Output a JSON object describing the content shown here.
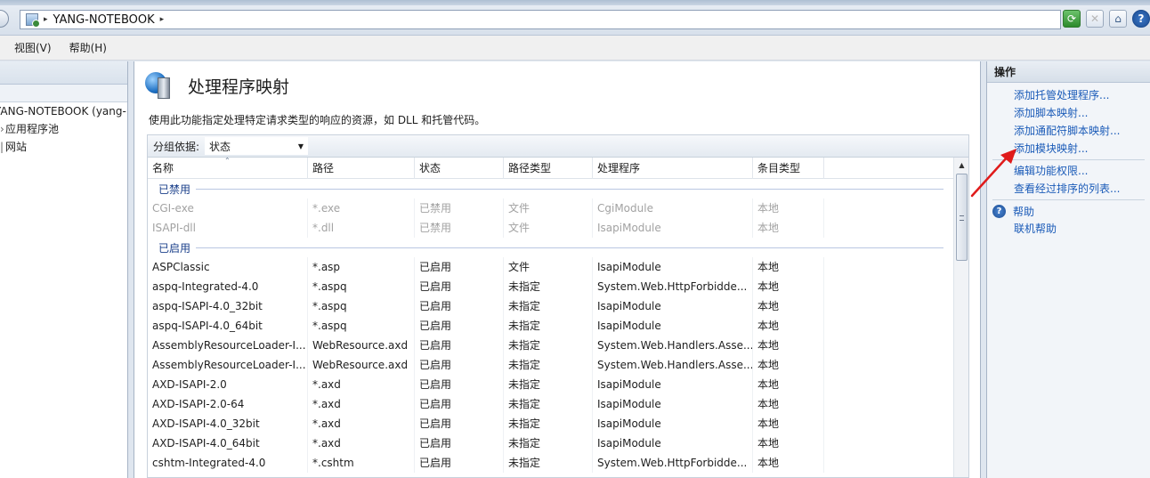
{
  "addressbar": {
    "crumb": "YANG-NOTEBOOK",
    "sep1": "▸",
    "sep2": "▸"
  },
  "menu": [
    {
      "label": "视图(V)"
    },
    {
      "label": "帮助(H)"
    }
  ],
  "tree": [
    {
      "label": "YANG-NOTEBOOK (yang-n"
    },
    {
      "label": "应用程序池"
    },
    {
      "label": "网站"
    }
  ],
  "page": {
    "title": "处理程序映射",
    "description": "使用此功能指定处理特定请求类型的响应的资源，如 DLL 和托管代码。",
    "groupby_label": "分组依据:",
    "groupby_value": "状态"
  },
  "columns": [
    "名称",
    "路径",
    "状态",
    "路径类型",
    "处理程序",
    "条目类型"
  ],
  "groups": [
    {
      "title": "已禁用",
      "disabled": true,
      "rows": [
        [
          "CGI-exe",
          "*.exe",
          "已禁用",
          "文件",
          "CgiModule",
          "本地"
        ],
        [
          "ISAPI-dll",
          "*.dll",
          "已禁用",
          "文件",
          "IsapiModule",
          "本地"
        ]
      ]
    },
    {
      "title": "已启用",
      "disabled": false,
      "rows": [
        [
          "ASPClassic",
          "*.asp",
          "已启用",
          "文件",
          "IsapiModule",
          "本地"
        ],
        [
          "aspq-Integrated-4.0",
          "*.aspq",
          "已启用",
          "未指定",
          "System.Web.HttpForbidde...",
          "本地"
        ],
        [
          "aspq-ISAPI-4.0_32bit",
          "*.aspq",
          "已启用",
          "未指定",
          "IsapiModule",
          "本地"
        ],
        [
          "aspq-ISAPI-4.0_64bit",
          "*.aspq",
          "已启用",
          "未指定",
          "IsapiModule",
          "本地"
        ],
        [
          "AssemblyResourceLoader-I...",
          "WebResource.axd",
          "已启用",
          "未指定",
          "System.Web.Handlers.Asse...",
          "本地"
        ],
        [
          "AssemblyResourceLoader-I...",
          "WebResource.axd",
          "已启用",
          "未指定",
          "System.Web.Handlers.Asse...",
          "本地"
        ],
        [
          "AXD-ISAPI-2.0",
          "*.axd",
          "已启用",
          "未指定",
          "IsapiModule",
          "本地"
        ],
        [
          "AXD-ISAPI-2.0-64",
          "*.axd",
          "已启用",
          "未指定",
          "IsapiModule",
          "本地"
        ],
        [
          "AXD-ISAPI-4.0_32bit",
          "*.axd",
          "已启用",
          "未指定",
          "IsapiModule",
          "本地"
        ],
        [
          "AXD-ISAPI-4.0_64bit",
          "*.axd",
          "已启用",
          "未指定",
          "IsapiModule",
          "本地"
        ],
        [
          "cshtm-Integrated-4.0",
          "*.cshtm",
          "已启用",
          "未指定",
          "System.Web.HttpForbidde...",
          "本地"
        ]
      ]
    }
  ],
  "actions": {
    "header": "操作",
    "group1": [
      "添加托管处理程序...",
      "添加脚本映射...",
      "添加通配符脚本映射...",
      "添加模块映射..."
    ],
    "group2": [
      "编辑功能权限...",
      "查看经过排序的列表..."
    ],
    "help": "帮助",
    "online_help": "联机帮助"
  },
  "colors": {
    "link": "#1b5bb8",
    "group_header": "#1a3f8a",
    "annotation_arrow": "#e01b1b"
  }
}
